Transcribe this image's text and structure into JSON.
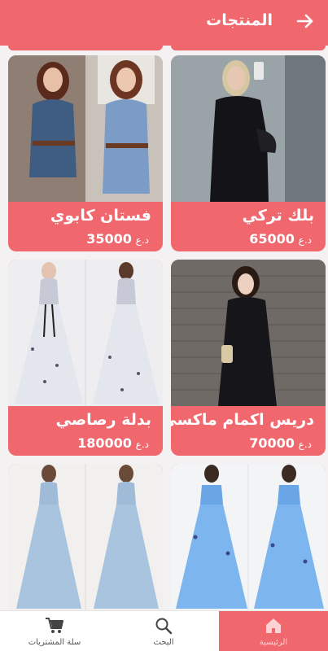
{
  "header": {
    "title": "المنتجات",
    "back_icon": "arrow-right-icon"
  },
  "products": [
    {
      "name": "فستان كابوي",
      "price": "35000",
      "currency": "د.ع"
    },
    {
      "name": "بلك تركي",
      "price": "65000",
      "currency": "د.ع"
    },
    {
      "name": "بدلة رصاصي",
      "price": "180000",
      "currency": "د.ع"
    },
    {
      "name": "دريس اكمام ماكسي",
      "price": "70000",
      "currency": "د.ع"
    },
    {
      "name": "",
      "price": "",
      "currency": ""
    },
    {
      "name": "",
      "price": "",
      "currency": ""
    }
  ],
  "bottom_nav": {
    "cart": "سلة المشتريات",
    "search": "البحث",
    "home": "الرئيسية"
  },
  "colors": {
    "accent": "#f0676d",
    "background": "#f3f1f1"
  }
}
